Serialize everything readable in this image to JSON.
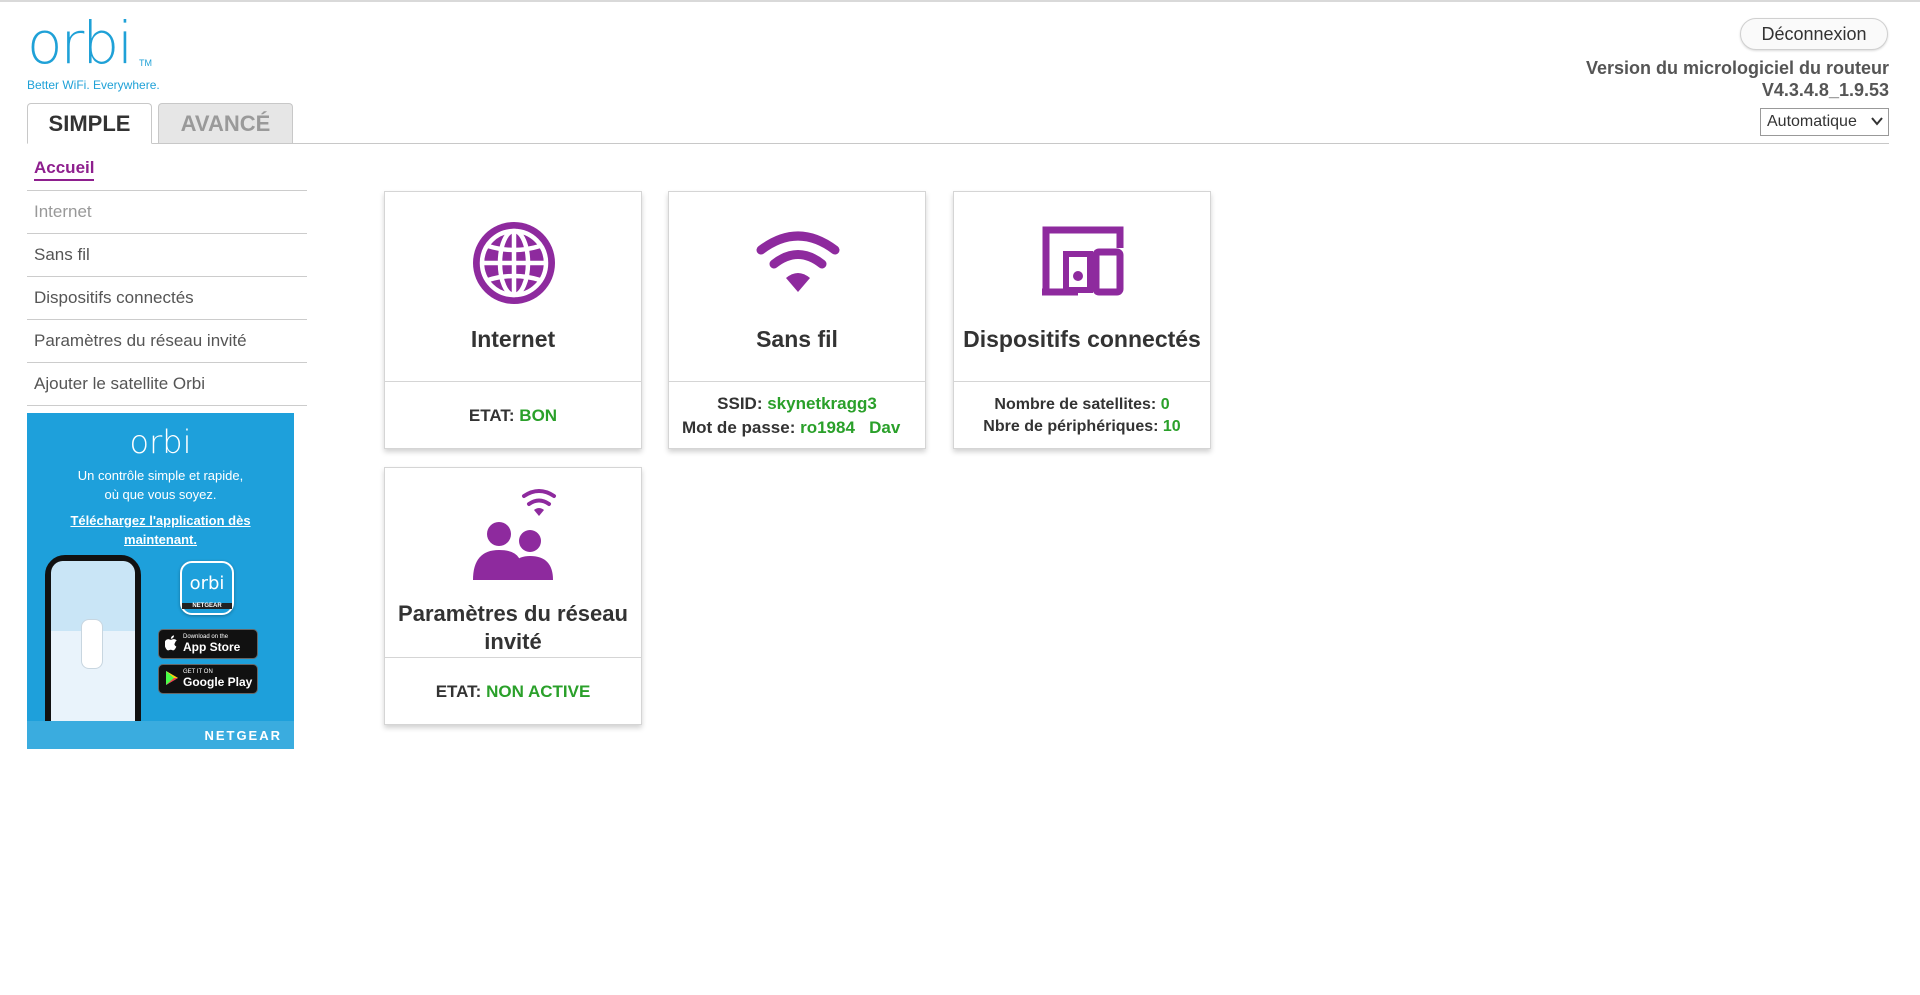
{
  "logo": {
    "word": "orbi",
    "tm": "TM",
    "tagline": "Better WiFi. Everywhere."
  },
  "tabs": [
    {
      "label": "SIMPLE",
      "active": true
    },
    {
      "label": "AVANCÉ",
      "active": false
    }
  ],
  "header": {
    "logout_label": "Déconnexion",
    "firmware_label": "Version du micrologiciel du routeur",
    "firmware_version": "V4.3.4.8_1.9.53",
    "language_selected": "Automatique"
  },
  "sidebar": {
    "items": [
      {
        "label": "Accueil",
        "active": true
      },
      {
        "label": "Internet",
        "muted": true
      },
      {
        "label": "Sans fil"
      },
      {
        "label": "Dispositifs connectés"
      },
      {
        "label": "Paramètres du réseau invité"
      },
      {
        "label": "Ajouter le satellite Orbi"
      }
    ]
  },
  "promo": {
    "logo": "orbi",
    "text_line1": "Un contrôle simple et rapide,",
    "text_line2": "où que vous soyez.",
    "link": "Téléchargez l'application dès maintenant.",
    "app_icon_word": "orbi",
    "app_icon_brand": "NETGEAR",
    "appstore_small": "Download on the",
    "appstore_big": "App Store",
    "googleplay_small": "GET IT ON",
    "googleplay_big": "Google Play",
    "brand": "NETGEAR"
  },
  "cards": {
    "internet": {
      "title": "Internet",
      "status_label": "ETAT:",
      "status_value": "BON",
      "icon": "globe-icon"
    },
    "wireless": {
      "title": "Sans fil",
      "ssid_label": "SSID:",
      "ssid_value": "skynetkragg3",
      "pass_label": "Mot de passe:",
      "pass_value": "ro1984   Dav",
      "icon": "wifi-icon"
    },
    "devices": {
      "title": "Dispositifs connectés",
      "satellites_label": "Nombre de satellites:",
      "satellites_value": "0",
      "devices_label": "Nbre de périphériques:",
      "devices_value": "10",
      "icon": "devices-icon"
    },
    "guest": {
      "title_line1": "Paramètres du réseau",
      "title_line2": "invité",
      "status_label": "ETAT:",
      "status_value": "NON ACTIVE",
      "icon": "guest-network-icon"
    }
  },
  "colors": {
    "accent_purple": "#8e2a9e",
    "brand_blue": "#1fa1d7",
    "status_green": "#2aa02a"
  }
}
